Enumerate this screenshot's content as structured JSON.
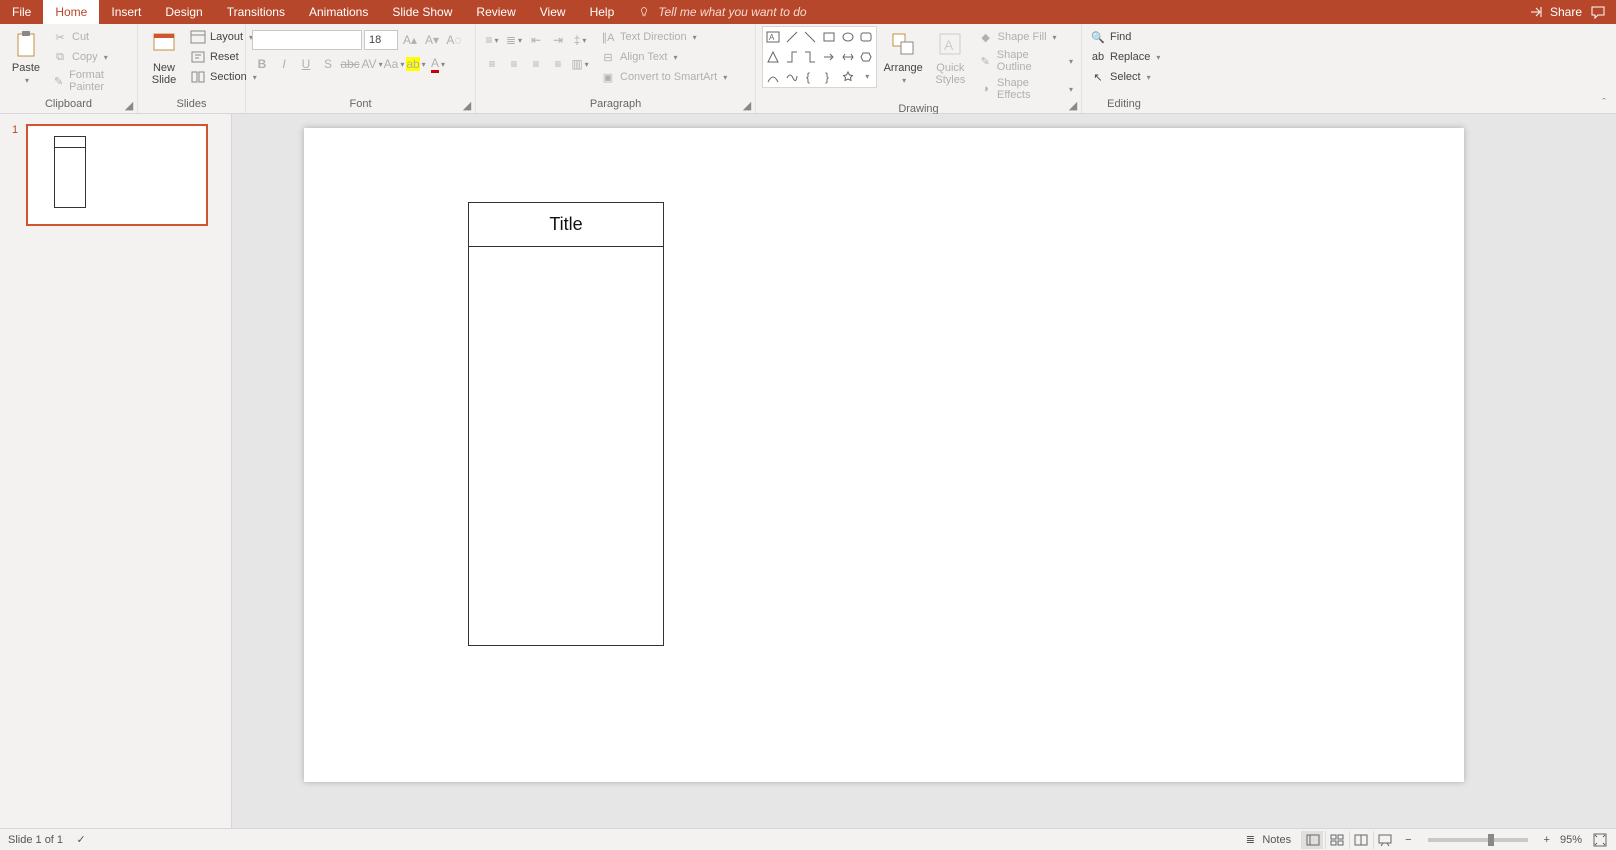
{
  "tabs": {
    "file": "File",
    "home": "Home",
    "insert": "Insert",
    "design": "Design",
    "transitions": "Transitions",
    "animations": "Animations",
    "slideshow": "Slide Show",
    "review": "Review",
    "view": "View",
    "help": "Help",
    "tellme": "Tell me what you want to do",
    "share": "Share"
  },
  "ribbon": {
    "clipboard": {
      "paste": "Paste",
      "cut": "Cut",
      "copy": "Copy",
      "format_painter": "Format Painter",
      "label": "Clipboard"
    },
    "slides": {
      "new_slide": "New\nSlide",
      "layout": "Layout",
      "reset": "Reset",
      "section": "Section",
      "label": "Slides"
    },
    "font": {
      "name_value": "",
      "size_value": "18",
      "label": "Font"
    },
    "paragraph": {
      "text_direction": "Text Direction",
      "align_text": "Align Text",
      "smartart": "Convert to SmartArt",
      "label": "Paragraph"
    },
    "drawing": {
      "arrange": "Arrange",
      "quick_styles": "Quick\nStyles",
      "shape_fill": "Shape Fill",
      "shape_outline": "Shape Outline",
      "shape_effects": "Shape Effects",
      "label": "Drawing"
    },
    "editing": {
      "find": "Find",
      "replace": "Replace",
      "select": "Select",
      "label": "Editing"
    }
  },
  "thumbnails": {
    "slide1_num": "1"
  },
  "slide": {
    "title_text": "Title"
  },
  "status": {
    "slide_of": "Slide 1 of 1",
    "notes": "Notes",
    "zoom": "95%"
  }
}
